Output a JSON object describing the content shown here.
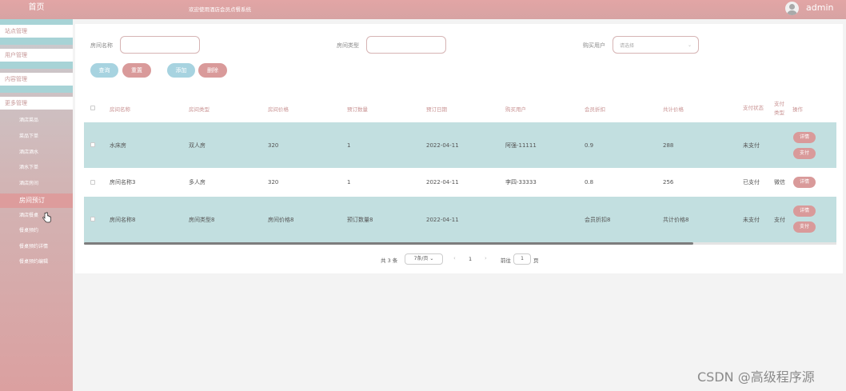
{
  "topbar": {
    "home": "首页",
    "welcome": "欢迎使用酒店会员点餐系统",
    "user": "admin"
  },
  "sidebar": {
    "groups": [
      {
        "label": "站点管理"
      },
      {
        "label": "用户管理"
      },
      {
        "label": "内容管理"
      },
      {
        "label": "更多管理"
      }
    ],
    "items": [
      {
        "label": "酒店菜品"
      },
      {
        "label": "菜品下单"
      },
      {
        "label": "酒店酒水"
      },
      {
        "label": "酒水下单"
      },
      {
        "label": "酒店房间"
      },
      {
        "label": "房间预订"
      },
      {
        "label": "酒店餐桌"
      },
      {
        "label": "餐桌预约"
      },
      {
        "label": "餐桌预约详情"
      },
      {
        "label": "餐桌预约编辑"
      }
    ],
    "active_index": 5
  },
  "search": {
    "room_name_label": "房间名称",
    "room_name_value": "",
    "room_type_label": "房间类型",
    "room_type_value": "",
    "buyer_label": "购买用户",
    "buyer_placeholder": "请选择"
  },
  "buttons": {
    "query": "查询",
    "reset": "重置",
    "add": "添加",
    "delete": "删除"
  },
  "table": {
    "headers": [
      "房间名称",
      "房间类型",
      "房间价格",
      "预订数量",
      "预订日期",
      "购买用户",
      "会员折扣",
      "共计价格",
      "支付状态",
      "支付类型",
      "操作"
    ],
    "rows": [
      {
        "name": "水床房",
        "type": "双人房",
        "price": "320",
        "qty": "1",
        "date": "2022-04-11",
        "buyer": "阿强-11111",
        "discount": "0.9",
        "total": "288",
        "pay_status": "未支付",
        "pay_type": "",
        "ops": [
          "详情",
          "支付"
        ]
      },
      {
        "name": "房间名称3",
        "type": "多人房",
        "price": "320",
        "qty": "1",
        "date": "2022-04-11",
        "buyer": "李四-33333",
        "discount": "0.8",
        "total": "256",
        "pay_status": "已支付",
        "pay_type": "微信",
        "ops": [
          "详情"
        ]
      },
      {
        "name": "房间名称8",
        "type": "房间类型8",
        "price": "房间价格8",
        "qty": "预订数量8",
        "date": "2022-04-11",
        "buyer": "",
        "discount": "会员折扣8",
        "total": "共计价格8",
        "pay_status": "未支付",
        "pay_type": "支付",
        "ops": [
          "详情",
          "支付"
        ]
      }
    ]
  },
  "pagination": {
    "total": "共 3 条",
    "page_size": "7条/页",
    "current": "1",
    "goto_label": "前往",
    "goto_value": "1",
    "page_suffix": "页"
  },
  "watermark": "CSDN @高级程序源",
  "colors": {
    "accent_pink": "#d99a9a",
    "accent_blue": "#a7d3e0",
    "row_shade": "#c2dfe0"
  }
}
